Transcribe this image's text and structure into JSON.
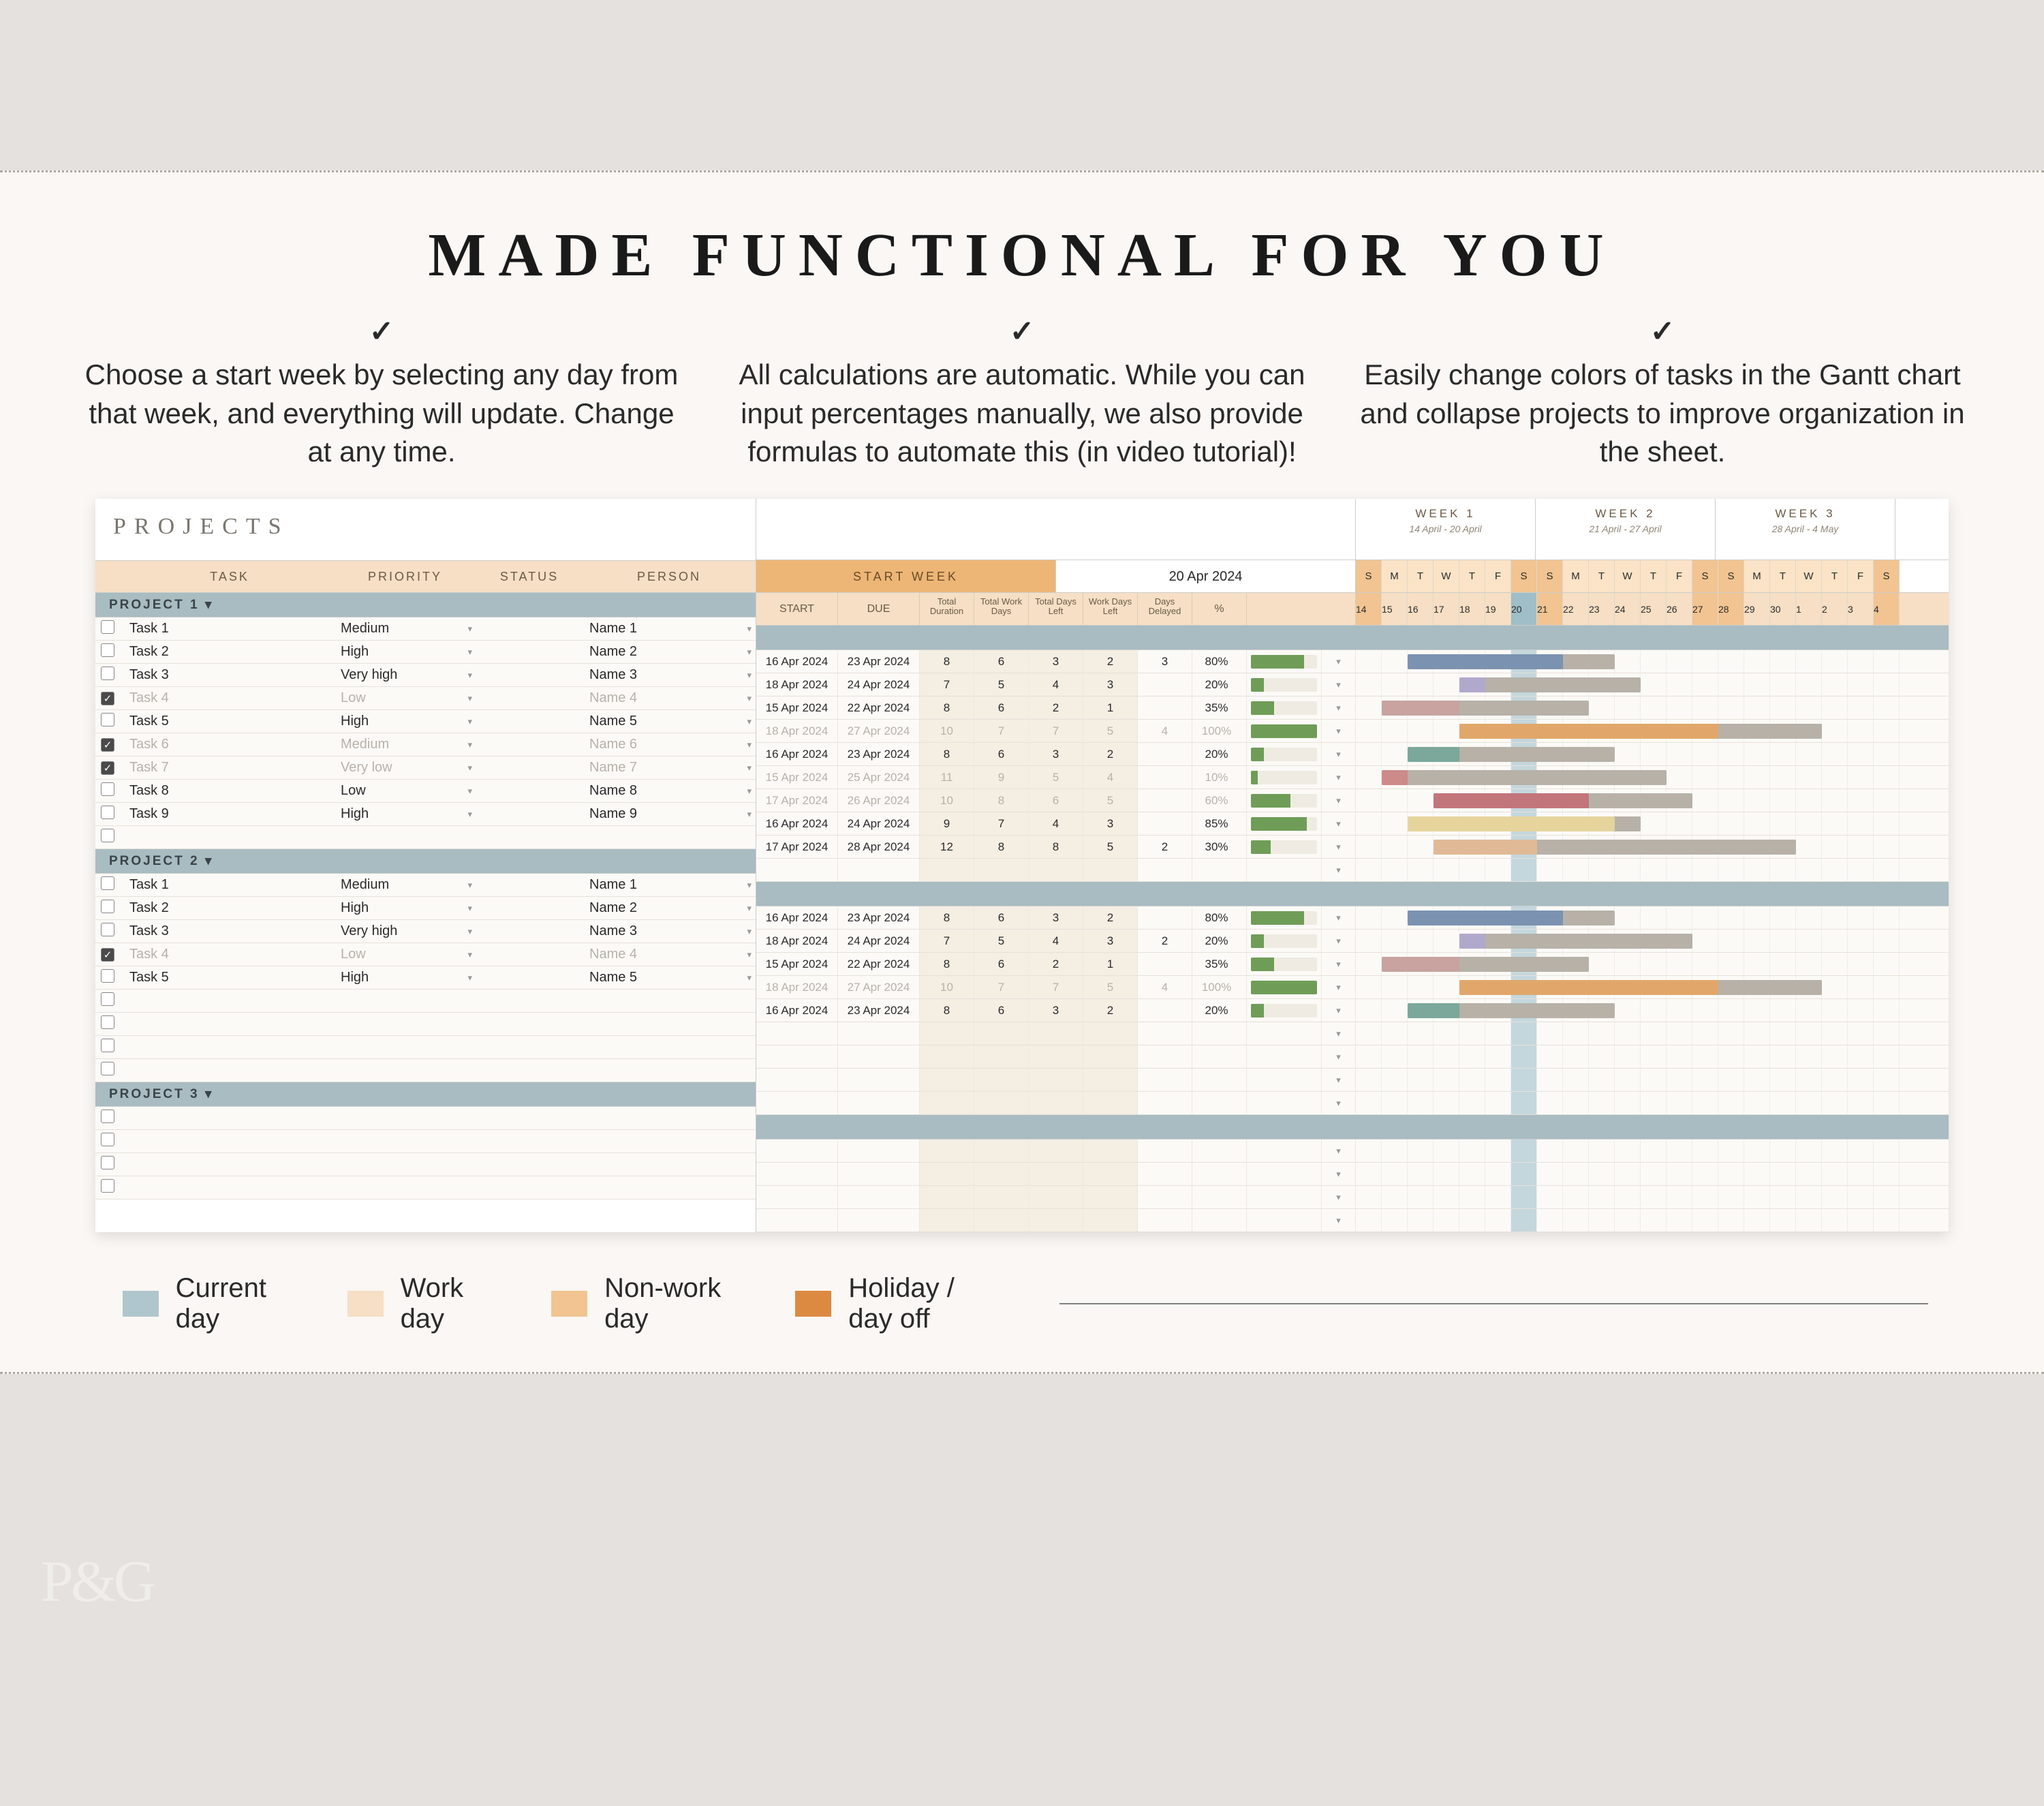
{
  "headline": "MADE FUNCTIONAL FOR YOU",
  "features": [
    "Choose a start week by selecting any day from that week, and everything will update. Change at any time.",
    "All calculations are automatic. While you can input percentages manually, we also provide formulas to automate this (in video tutorial)!",
    "Easily change colors of tasks in the Gantt chart and collapse projects to improve organization in the sheet."
  ],
  "sheet": {
    "title": "PROJECTS",
    "left_headers": {
      "task": "TASK",
      "priority": "PRIORITY",
      "status": "STATUS",
      "person": "PERSON"
    },
    "right_headers": {
      "start_week_label": "START WEEK",
      "start_week_value": "20 Apr 2024",
      "start": "START",
      "due": "DUE",
      "total_duration": "Total Duration",
      "total_work_days": "Total Work Days",
      "total_days_left": "Total Days Left",
      "work_days_left": "Work Days Left",
      "days_delayed": "Days Delayed",
      "percent": "%"
    },
    "weeks": [
      {
        "label": "WEEK 1",
        "range": "14 April - 20 April"
      },
      {
        "label": "WEEK 2",
        "range": "21 April - 27 April"
      },
      {
        "label": "WEEK 3",
        "range": "28 April - 4 May"
      }
    ],
    "day_letters": [
      "S",
      "M",
      "T",
      "W",
      "T",
      "F",
      "S",
      "S",
      "M",
      "T",
      "W",
      "T",
      "F",
      "S",
      "S",
      "M",
      "T",
      "W",
      "T",
      "F",
      "S"
    ],
    "day_numbers": [
      "14",
      "15",
      "16",
      "17",
      "18",
      "19",
      "20",
      "21",
      "22",
      "23",
      "24",
      "25",
      "26",
      "27",
      "28",
      "29",
      "30",
      "1",
      "2",
      "3",
      "4"
    ],
    "weekend_idx": [
      0,
      6,
      7,
      13,
      14,
      20
    ],
    "current_idx": 6,
    "sections": [
      {
        "name": "PROJECT 1",
        "rows": [
          {
            "done": false,
            "task": "Task 1",
            "priority": "Medium",
            "status": "",
            "person": "Name 1",
            "start": "16 Apr 2024",
            "due": "23 Apr 2024",
            "dur": "8",
            "wd": "6",
            "dl": "3",
            "wdl": "2",
            "delay": "3",
            "pct": 80,
            "bar": {
              "s": 2,
              "len": 8,
              "color": "#7b93b0",
              "done": 6
            }
          },
          {
            "done": false,
            "task": "Task 2",
            "priority": "High",
            "status": "",
            "person": "Name 2",
            "start": "18 Apr 2024",
            "due": "24 Apr 2024",
            "dur": "7",
            "wd": "5",
            "dl": "4",
            "wdl": "3",
            "delay": "",
            "pct": 20,
            "bar": {
              "s": 4,
              "len": 7,
              "color": "#b1a9cc",
              "done": 1
            }
          },
          {
            "done": false,
            "task": "Task 3",
            "priority": "Very high",
            "status": "",
            "person": "Name 3",
            "start": "15 Apr 2024",
            "due": "22 Apr 2024",
            "dur": "8",
            "wd": "6",
            "dl": "2",
            "wdl": "1",
            "delay": "",
            "pct": 35,
            "bar": {
              "s": 1,
              "len": 8,
              "color": "#c8a3a0",
              "done": 3
            }
          },
          {
            "done": true,
            "task": "Task 4",
            "priority": "Low",
            "status": "",
            "person": "Name 4",
            "start": "18 Apr 2024",
            "due": "27 Apr 2024",
            "dur": "10",
            "wd": "7",
            "dl": "7",
            "wdl": "5",
            "delay": "4",
            "pct": 100,
            "bar": {
              "s": 4,
              "len": 14,
              "color": "#e1a76a",
              "done": 10
            }
          },
          {
            "done": false,
            "task": "Task 5",
            "priority": "High",
            "status": "",
            "person": "Name 5",
            "start": "16 Apr 2024",
            "due": "23 Apr 2024",
            "dur": "8",
            "wd": "6",
            "dl": "3",
            "wdl": "2",
            "delay": "",
            "pct": 20,
            "bar": {
              "s": 2,
              "len": 8,
              "color": "#7ba89b",
              "done": 2
            }
          },
          {
            "done": true,
            "task": "Task 6",
            "priority": "Medium",
            "status": "",
            "person": "Name 6",
            "start": "15 Apr 2024",
            "due": "25 Apr 2024",
            "dur": "11",
            "wd": "9",
            "dl": "5",
            "wdl": "4",
            "delay": "",
            "pct": 10,
            "bar": {
              "s": 1,
              "len": 11,
              "color": "#cc8a88",
              "done": 1
            }
          },
          {
            "done": true,
            "task": "Task 7",
            "priority": "Very low",
            "status": "",
            "person": "Name 7",
            "start": "17 Apr 2024",
            "due": "26 Apr 2024",
            "dur": "10",
            "wd": "8",
            "dl": "6",
            "wdl": "5",
            "delay": "",
            "pct": 60,
            "bar": {
              "s": 3,
              "len": 10,
              "color": "#c2757a",
              "done": 6
            }
          },
          {
            "done": false,
            "task": "Task 8",
            "priority": "Low",
            "status": "",
            "person": "Name 8",
            "start": "16 Apr 2024",
            "due": "24 Apr 2024",
            "dur": "9",
            "wd": "7",
            "dl": "4",
            "wdl": "3",
            "delay": "",
            "pct": 85,
            "bar": {
              "s": 2,
              "len": 9,
              "color": "#e6d49c",
              "done": 8
            }
          },
          {
            "done": false,
            "task": "Task 9",
            "priority": "High",
            "status": "",
            "person": "Name 9",
            "start": "17 Apr 2024",
            "due": "28 Apr 2024",
            "dur": "12",
            "wd": "8",
            "dl": "8",
            "wdl": "5",
            "delay": "2",
            "pct": 30,
            "bar": {
              "s": 3,
              "len": 14,
              "color": "#e0ba97",
              "done": 4
            }
          },
          {
            "done": false,
            "task": "",
            "priority": "",
            "status": "",
            "person": "",
            "start": "",
            "due": "",
            "dur": "",
            "wd": "",
            "dl": "",
            "wdl": "",
            "delay": "",
            "pct": null,
            "bar": null
          }
        ]
      },
      {
        "name": "PROJECT 2",
        "rows": [
          {
            "done": false,
            "task": "Task 1",
            "priority": "Medium",
            "status": "",
            "person": "Name 1",
            "start": "16 Apr 2024",
            "due": "23 Apr 2024",
            "dur": "8",
            "wd": "6",
            "dl": "3",
            "wdl": "2",
            "delay": "",
            "pct": 80,
            "bar": {
              "s": 2,
              "len": 8,
              "color": "#7b93b0",
              "done": 6
            }
          },
          {
            "done": false,
            "task": "Task 2",
            "priority": "High",
            "status": "",
            "person": "Name 2",
            "start": "18 Apr 2024",
            "due": "24 Apr 2024",
            "dur": "7",
            "wd": "5",
            "dl": "4",
            "wdl": "3",
            "delay": "2",
            "pct": 20,
            "bar": {
              "s": 4,
              "len": 9,
              "color": "#b1a9cc",
              "done": 1
            }
          },
          {
            "done": false,
            "task": "Task 3",
            "priority": "Very high",
            "status": "",
            "person": "Name 3",
            "start": "15 Apr 2024",
            "due": "22 Apr 2024",
            "dur": "8",
            "wd": "6",
            "dl": "2",
            "wdl": "1",
            "delay": "",
            "pct": 35,
            "bar": {
              "s": 1,
              "len": 8,
              "color": "#c8a3a0",
              "done": 3
            }
          },
          {
            "done": true,
            "task": "Task 4",
            "priority": "Low",
            "status": "",
            "person": "Name 4",
            "start": "18 Apr 2024",
            "due": "27 Apr 2024",
            "dur": "10",
            "wd": "7",
            "dl": "7",
            "wdl": "5",
            "delay": "4",
            "pct": 100,
            "bar": {
              "s": 4,
              "len": 14,
              "color": "#e1a76a",
              "done": 10
            }
          },
          {
            "done": false,
            "task": "Task 5",
            "priority": "High",
            "status": "",
            "person": "Name 5",
            "start": "16 Apr 2024",
            "due": "23 Apr 2024",
            "dur": "8",
            "wd": "6",
            "dl": "3",
            "wdl": "2",
            "delay": "",
            "pct": 20,
            "bar": {
              "s": 2,
              "len": 8,
              "color": "#7ba89b",
              "done": 2
            }
          },
          {
            "done": false,
            "task": "",
            "priority": "",
            "status": "",
            "person": "",
            "start": "",
            "due": "",
            "dur": "",
            "wd": "",
            "dl": "",
            "wdl": "",
            "delay": "",
            "pct": null,
            "bar": null
          },
          {
            "done": false,
            "task": "",
            "priority": "",
            "status": "",
            "person": "",
            "start": "",
            "due": "",
            "dur": "",
            "wd": "",
            "dl": "",
            "wdl": "",
            "delay": "",
            "pct": null,
            "bar": null
          },
          {
            "done": false,
            "task": "",
            "priority": "",
            "status": "",
            "person": "",
            "start": "",
            "due": "",
            "dur": "",
            "wd": "",
            "dl": "",
            "wdl": "",
            "delay": "",
            "pct": null,
            "bar": null
          },
          {
            "done": false,
            "task": "",
            "priority": "",
            "status": "",
            "person": "",
            "start": "",
            "due": "",
            "dur": "",
            "wd": "",
            "dl": "",
            "wdl": "",
            "delay": "",
            "pct": null,
            "bar": null
          }
        ]
      },
      {
        "name": "PROJECT 3",
        "rows": [
          {
            "done": false,
            "task": "",
            "priority": "",
            "status": "",
            "person": "",
            "start": "",
            "due": "",
            "dur": "",
            "wd": "",
            "dl": "",
            "wdl": "",
            "delay": "",
            "pct": null,
            "bar": null
          },
          {
            "done": false,
            "task": "",
            "priority": "",
            "status": "",
            "person": "",
            "start": "",
            "due": "",
            "dur": "",
            "wd": "",
            "dl": "",
            "wdl": "",
            "delay": "",
            "pct": null,
            "bar": null
          },
          {
            "done": false,
            "task": "",
            "priority": "",
            "status": "",
            "person": "",
            "start": "",
            "due": "",
            "dur": "",
            "wd": "",
            "dl": "",
            "wdl": "",
            "delay": "",
            "pct": null,
            "bar": null
          },
          {
            "done": false,
            "task": "",
            "priority": "",
            "status": "",
            "person": "",
            "start": "",
            "due": "",
            "dur": "",
            "wd": "",
            "dl": "",
            "wdl": "",
            "delay": "",
            "pct": null,
            "bar": null
          }
        ]
      }
    ]
  },
  "legend": {
    "items": [
      {
        "label": "Current day",
        "color": "#b0c6cd"
      },
      {
        "label": "Work day",
        "color": "#f6dfc4"
      },
      {
        "label": "Non-work day",
        "color": "#f1c491"
      },
      {
        "label": "Holiday / day off",
        "color": "#dc8a42"
      }
    ]
  },
  "logo": "P&G"
}
